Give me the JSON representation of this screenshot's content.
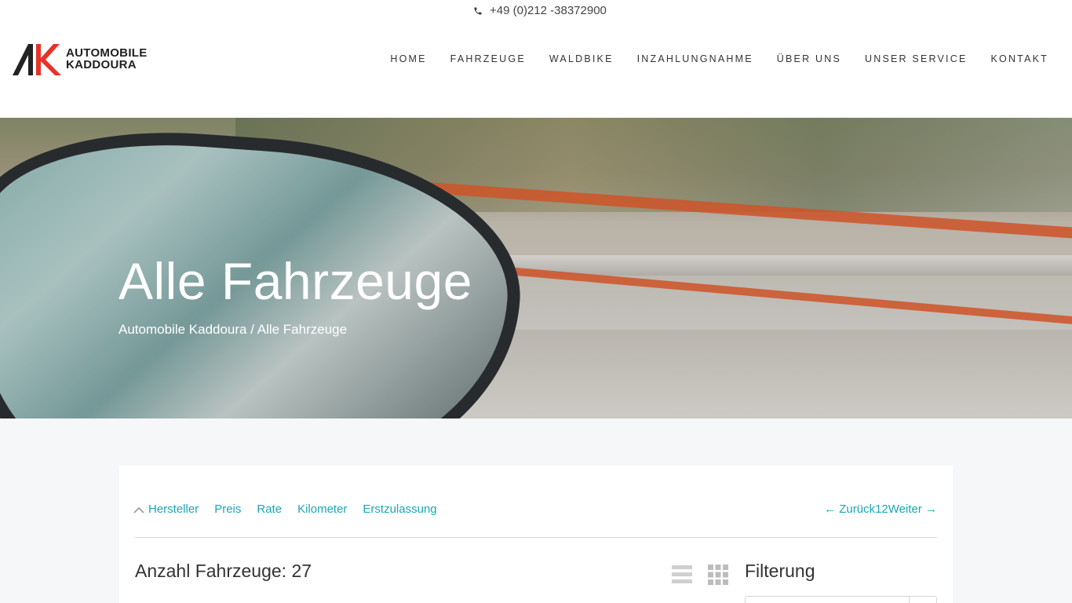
{
  "topbar": {
    "phone": "+49 (0)212 -38372900",
    "phone_icon": "phone-icon"
  },
  "logo": {
    "line1": "AUTOMOBILE",
    "line2": "KADDOURA",
    "accent": "#e63329"
  },
  "nav": [
    {
      "label": "HOME"
    },
    {
      "label": "FAHRZEUGE"
    },
    {
      "label": "WALDBIKE"
    },
    {
      "label": "INZAHLUNGNAHME"
    },
    {
      "label": "ÜBER UNS"
    },
    {
      "label": "UNSER SERVICE"
    },
    {
      "label": "KONTAKT"
    }
  ],
  "hero": {
    "title": "Alle Fahrzeuge",
    "breadcrumb": "Automobile Kaddoura / Alle Fahrzeuge"
  },
  "sort": {
    "items": [
      "Hersteller",
      "Preis",
      "Rate",
      "Kilometer",
      "Erstzulassung"
    ],
    "active_icon": "chevron-up-icon"
  },
  "pager": {
    "prev": "← Zurück",
    "pages": [
      "1",
      "2"
    ],
    "next": "Weiter →"
  },
  "listing": {
    "count_text": "Anzahl Fahrzeuge: 27"
  },
  "filter": {
    "title": "Filterung"
  },
  "colors": {
    "link": "#1aa7b4",
    "accent": "#e63329"
  }
}
